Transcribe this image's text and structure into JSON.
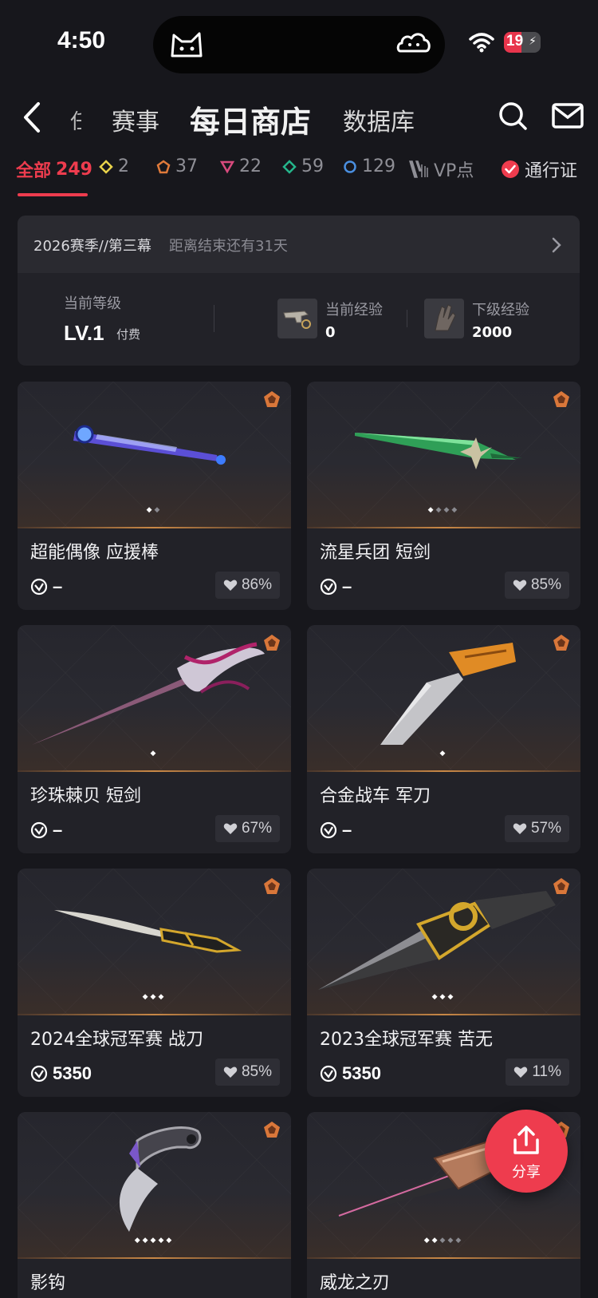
{
  "status_bar": {
    "time": "4:50",
    "battery": "19"
  },
  "nav": {
    "partial_tab": "任",
    "tabs": [
      {
        "label": "赛事"
      },
      {
        "label": "每日商店"
      },
      {
        "label": "数据库"
      }
    ]
  },
  "filters": {
    "all": {
      "label": "全部",
      "count": "249"
    },
    "tiers": [
      {
        "count": "2",
        "color": "#e9d34a"
      },
      {
        "count": "37",
        "color": "#e07a3a"
      },
      {
        "count": "22",
        "color": "#d84a7d"
      },
      {
        "count": "59",
        "color": "#25b58b"
      },
      {
        "count": "129",
        "color": "#4a8fe0"
      }
    ],
    "vp": "VP点",
    "pass": "通行证"
  },
  "season": {
    "title": "2026赛季//第三幕",
    "remaining": "距离结束还有31天",
    "level_label": "当前等级",
    "level_value": "LV.1",
    "paid_label": "付费",
    "current_exp_label": "当前经验",
    "current_exp_value": "0",
    "next_exp_label": "下级经验",
    "next_exp_value": "2000"
  },
  "items": [
    {
      "name": "超能偶像 应援棒",
      "price": "–",
      "like": "86%",
      "dots_on": 1,
      "dots_total": 2
    },
    {
      "name": "流星兵团 短剑",
      "price": "–",
      "like": "85%",
      "dots_on": 1,
      "dots_total": 4
    },
    {
      "name": "珍珠棘贝 短剑",
      "price": "–",
      "like": "67%",
      "dots_on": 1,
      "dots_total": 1
    },
    {
      "name": "合金战车 军刀",
      "price": "–",
      "like": "57%",
      "dots_on": 1,
      "dots_total": 1
    },
    {
      "name": "2024全球冠军赛 战刀",
      "price": "5350",
      "like": "85%",
      "dots_on": 3,
      "dots_total": 3
    },
    {
      "name": "2023全球冠军赛 苦无",
      "price": "5350",
      "like": "11%",
      "dots_on": 3,
      "dots_total": 3
    },
    {
      "name": "影钩",
      "price": "",
      "like": "",
      "dots_on": 5,
      "dots_total": 5
    },
    {
      "name": "威龙之刃",
      "price": "",
      "like": "",
      "dots_on": 2,
      "dots_total": 5
    }
  ],
  "share": {
    "label": "分享"
  }
}
